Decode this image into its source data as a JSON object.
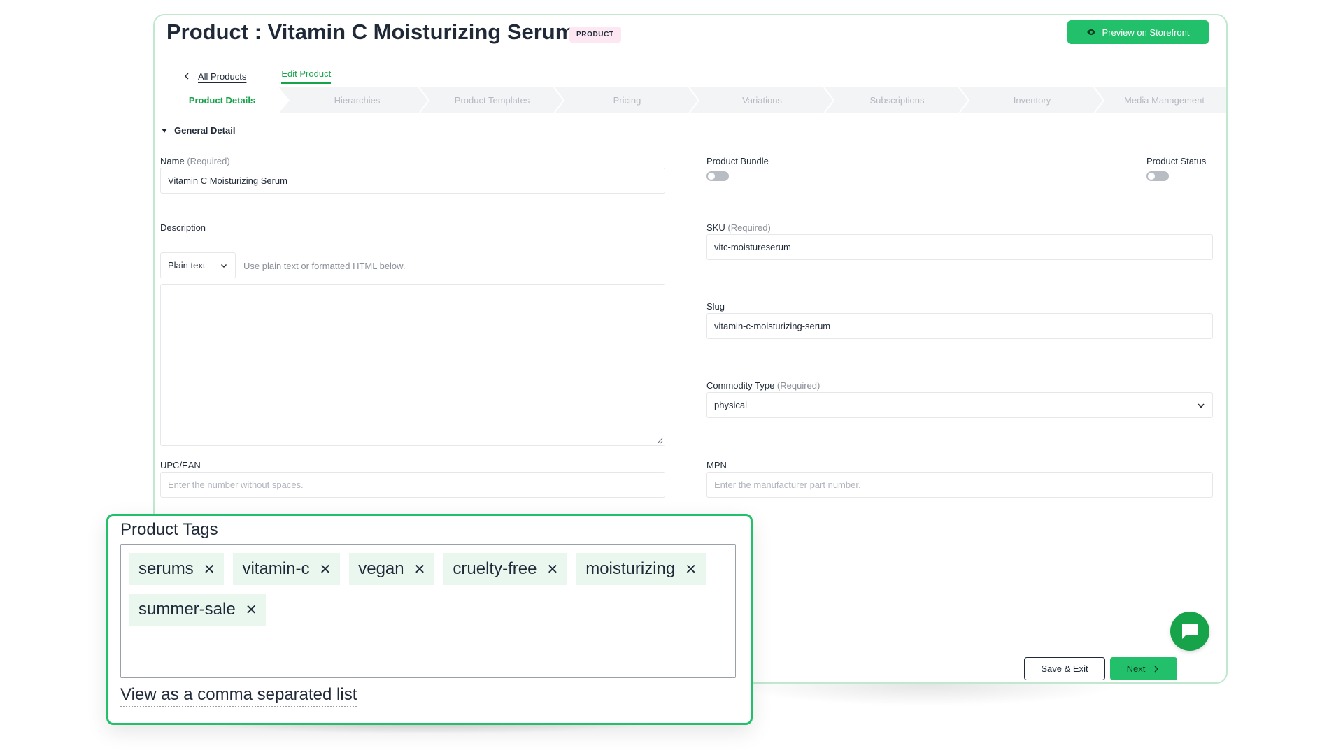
{
  "header": {
    "title": "Product : Vitamin C Moisturizing Serum",
    "badge": "PRODUCT",
    "preview_label": "Preview on Storefront"
  },
  "subnav": {
    "back_label": "All Products",
    "edit_label": "Edit Product"
  },
  "steps": [
    {
      "label": "Product Details",
      "active": true
    },
    {
      "label": "Hierarchies"
    },
    {
      "label": "Product Templates"
    },
    {
      "label": "Pricing"
    },
    {
      "label": "Variations"
    },
    {
      "label": "Subscriptions"
    },
    {
      "label": "Inventory"
    },
    {
      "label": "Media Management"
    }
  ],
  "section": {
    "title": "General Detail"
  },
  "form": {
    "name_label": "Name",
    "required": "(Required)",
    "name_value": "Vitamin C Moisturizing Serum",
    "bundle_label": "Product Bundle",
    "status_label": "Product Status",
    "description_label": "Description",
    "format_value": "Plain text",
    "format_hint": "Use plain text or formatted HTML below.",
    "sku_label": "SKU",
    "sku_value": "vitc-moistureserum",
    "slug_label": "Slug",
    "slug_value": "vitamin-c-moisturizing-serum",
    "commodity_label": "Commodity Type",
    "commodity_value": "physical",
    "upc_label": "UPC/EAN",
    "upc_placeholder": "Enter the number without spaces.",
    "mpn_label": "MPN",
    "mpn_placeholder": "Enter the manufacturer part number."
  },
  "footer": {
    "save_label": "Save & Exit",
    "next_label": "Next"
  },
  "tags_panel": {
    "title": "Product Tags",
    "tags": [
      "serums",
      "vitamin-c",
      "vegan",
      "cruelty-free",
      "moisturizing",
      "summer-sale"
    ],
    "comma_link": "View as a comma separated list"
  },
  "colors": {
    "accent": "#22c06a",
    "accent_text": "#16a34a",
    "badge_bg": "#fce7f3",
    "tag_bg": "#eaf7ef"
  }
}
